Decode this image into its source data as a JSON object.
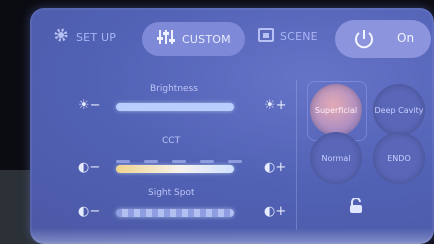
{
  "tabs": {
    "setup": {
      "label": "SET UP",
      "icon": "gear-icon"
    },
    "custom": {
      "label": "CUSTOM",
      "icon": "sliders-icon",
      "active": true
    },
    "scene": {
      "label": "SCENE",
      "icon": "scene-icon"
    }
  },
  "power": {
    "label": "On",
    "icon": "power-icon"
  },
  "sliders": [
    {
      "label": "Brightness",
      "minus": "☀−",
      "plus": "☀+"
    },
    {
      "label": "CCT",
      "minus": "◐−",
      "plus": "◐+"
    },
    {
      "label": "Sight Spot",
      "minus": "◐−",
      "plus": "◐+"
    }
  ],
  "modes": [
    {
      "label": "Superficial",
      "active": true
    },
    {
      "label": "Deep Cavity",
      "active": false
    },
    {
      "label": "Normal",
      "active": false
    },
    {
      "label": "ENDO",
      "active": false
    }
  ],
  "lock": {
    "icon": "unlock-icon"
  }
}
